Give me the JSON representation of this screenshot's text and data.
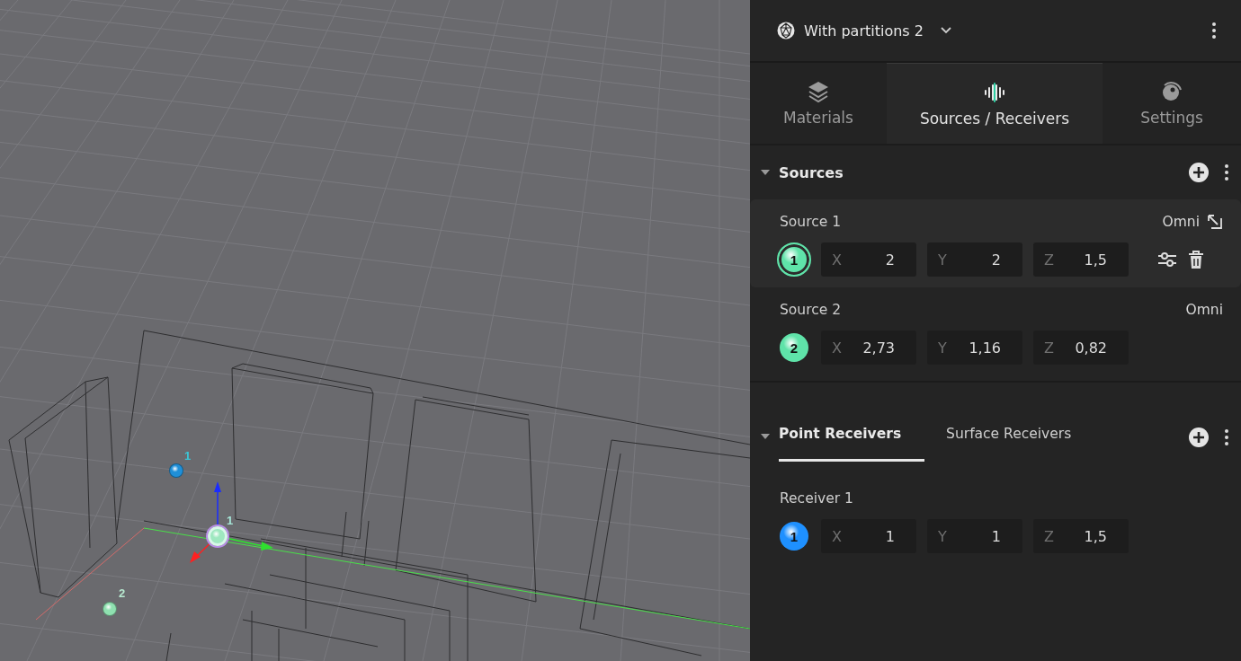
{
  "viewport": {
    "markers": [
      {
        "label": "1",
        "color": "#1f8fd8",
        "kind": "plain"
      },
      {
        "label": "1",
        "color": "#9fe8c0",
        "kind": "selected"
      },
      {
        "label": "2",
        "color": "#8fe0b0",
        "kind": "plain"
      }
    ]
  },
  "header": {
    "title": "With partitions 2"
  },
  "tabs": [
    {
      "label": "Materials",
      "selected": false,
      "kind": "layers"
    },
    {
      "label": "Sources / Receivers",
      "selected": true,
      "kind": "wave"
    },
    {
      "label": "Settings",
      "selected": false,
      "kind": "knob"
    }
  ],
  "sources": {
    "title": "Sources",
    "expanded": true,
    "items": [
      {
        "name": "Source 1",
        "type": "Omni",
        "selected": true,
        "number": "1",
        "color": "#5fe3a9",
        "coords": [
          {
            "axis": "X",
            "value": "2"
          },
          {
            "axis": "Y",
            "value": "2"
          },
          {
            "axis": "Z",
            "value": "1,5"
          }
        ]
      },
      {
        "name": "Source 2",
        "type": "Omni",
        "selected": false,
        "number": "2",
        "color": "#5fe3a9",
        "coords": [
          {
            "axis": "X",
            "value": "2,73"
          },
          {
            "axis": "Y",
            "value": "1,16"
          },
          {
            "axis": "Z",
            "value": "0,82"
          }
        ]
      }
    ]
  },
  "receivers": {
    "expanded": true,
    "tabs": [
      {
        "label": "Point Receivers",
        "selected": true
      },
      {
        "label": "Surface Receivers",
        "selected": false
      }
    ],
    "items": [
      {
        "name": "Receiver 1",
        "selected": false,
        "number": "1",
        "color": "#1e90ff",
        "coords": [
          {
            "axis": "X",
            "value": "1"
          },
          {
            "axis": "Y",
            "value": "1"
          },
          {
            "axis": "Z",
            "value": "1,5"
          }
        ]
      }
    ]
  }
}
